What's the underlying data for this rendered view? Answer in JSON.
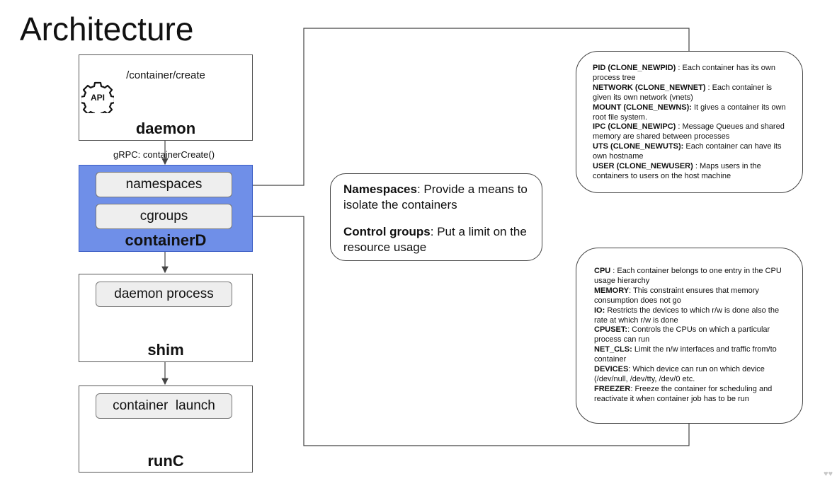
{
  "title": "Architecture",
  "daemon": {
    "endpoint": "/container/create",
    "api_icon_text": "API",
    "label": "daemon"
  },
  "grpc_label": "gRPC: containerCreate()",
  "containerd": {
    "label": "containerD",
    "namespaces": "namespaces",
    "cgroups": "cgroups",
    "color": "#6f8fe8"
  },
  "shim": {
    "process": "daemon process",
    "label": "shim"
  },
  "runc": {
    "process": "container  launch",
    "label": "runC"
  },
  "summary": [
    {
      "term": "Namespaces",
      "desc": ": Provide a means to isolate the containers"
    },
    {
      "term": "Control groups",
      "desc": ": Put a limit on the resource usage"
    }
  ],
  "namespaces_list": [
    {
      "term": "PID (CLONE_NEWPID)",
      "desc": " : Each container has its own process tree"
    },
    {
      "term": "NETWORK (CLONE_NEWNET)",
      "desc": " : Each container is given its own network (vnets)"
    },
    {
      "term": "MOUNT (CLONE_NEWNS):",
      "desc": " It gives a container its own root file system."
    },
    {
      "term": "IPC (CLONE_NEWIPC)",
      "desc": " : Message Queues and shared memory are shared between processes"
    },
    {
      "term": "UTS (CLONE_NEWUTS):",
      "desc": " Each container can have its own hostname"
    },
    {
      "term": "USER (CLONE_NEWUSER)",
      "desc": " : Maps users in the containers to users on the host machine"
    }
  ],
  "cgroups_list": [
    {
      "term": "CPU",
      "desc": " : Each container belongs to one entry in the CPU usage hierarchy"
    },
    {
      "term": "MEMORY",
      "desc": ": This constraint ensures that memory consumption does not go"
    },
    {
      "term": "IO:",
      "desc": " Restricts the devices to which r/w is done also the rate at which r/w is done"
    },
    {
      "term": "CPUSET:",
      "desc": ": Controls the CPUs on which a particular process can run"
    },
    {
      "term": "NET_CLS:",
      "desc": " Limit the n/w interfaces and traffic from/to container"
    },
    {
      "term": "DEVICES",
      "desc": ": Which device can run on which device (/dev/null, /dev/tty, /dev/0 etc."
    },
    {
      "term": "FREEZER",
      "desc": ": Freeze the container for scheduling and reactivate it when container job has to be run"
    }
  ]
}
